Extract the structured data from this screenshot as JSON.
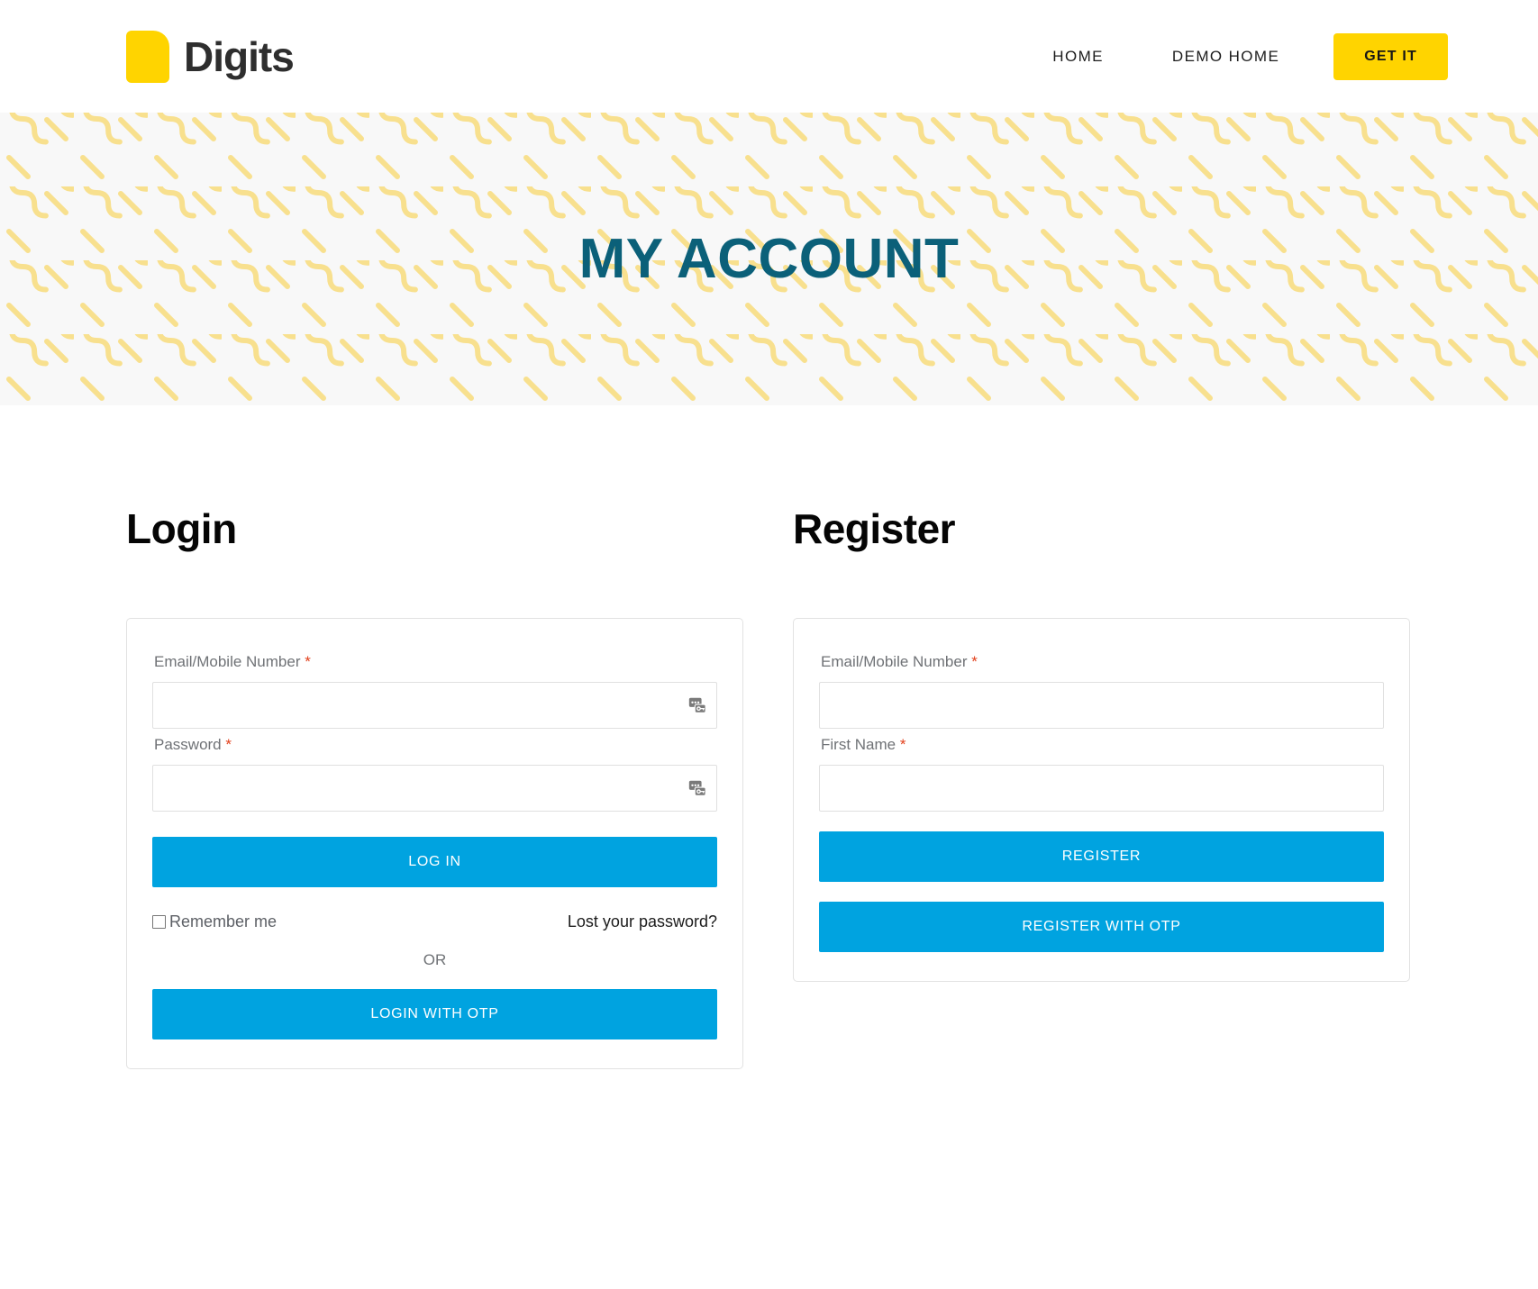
{
  "header": {
    "brand_name": "Digits",
    "brand_icon": "yellow-page-logo-icon",
    "nav": [
      {
        "label": "HOME"
      },
      {
        "label": "DEMO HOME"
      }
    ],
    "cta_label": "GET IT"
  },
  "banner": {
    "title": "MY ACCOUNT",
    "background_color": "#f8f8f8",
    "pattern_color": "#f8e08e",
    "title_color": "#0B6079"
  },
  "login": {
    "heading": "Login",
    "email_label": "Email/Mobile Number",
    "email_required_mark": "*",
    "email_value": "",
    "email_placeholder": "",
    "password_label": "Password",
    "password_required_mark": "*",
    "password_value": "",
    "password_placeholder": "",
    "submit_label": "LOG IN",
    "remember_label": "Remember me",
    "remember_checked": false,
    "lost_password_label": "Lost your password?",
    "or_label": "OR",
    "otp_label": "LOGIN WITH OTP",
    "autofill_icon": "password-manager-icon"
  },
  "register": {
    "heading": "Register",
    "email_label": "Email/Mobile Number",
    "email_required_mark": "*",
    "email_value": "",
    "email_placeholder": "",
    "first_name_label": "First Name",
    "first_name_required_mark": "*",
    "first_name_value": "",
    "first_name_placeholder": "",
    "submit_label": "REGISTER",
    "otp_label": "REGISTER WITH OTP"
  },
  "colors": {
    "accent_blue": "#00A3E0",
    "brand_yellow": "#FFD400",
    "teal": "#0B6079",
    "required_red": "#e2401c"
  }
}
